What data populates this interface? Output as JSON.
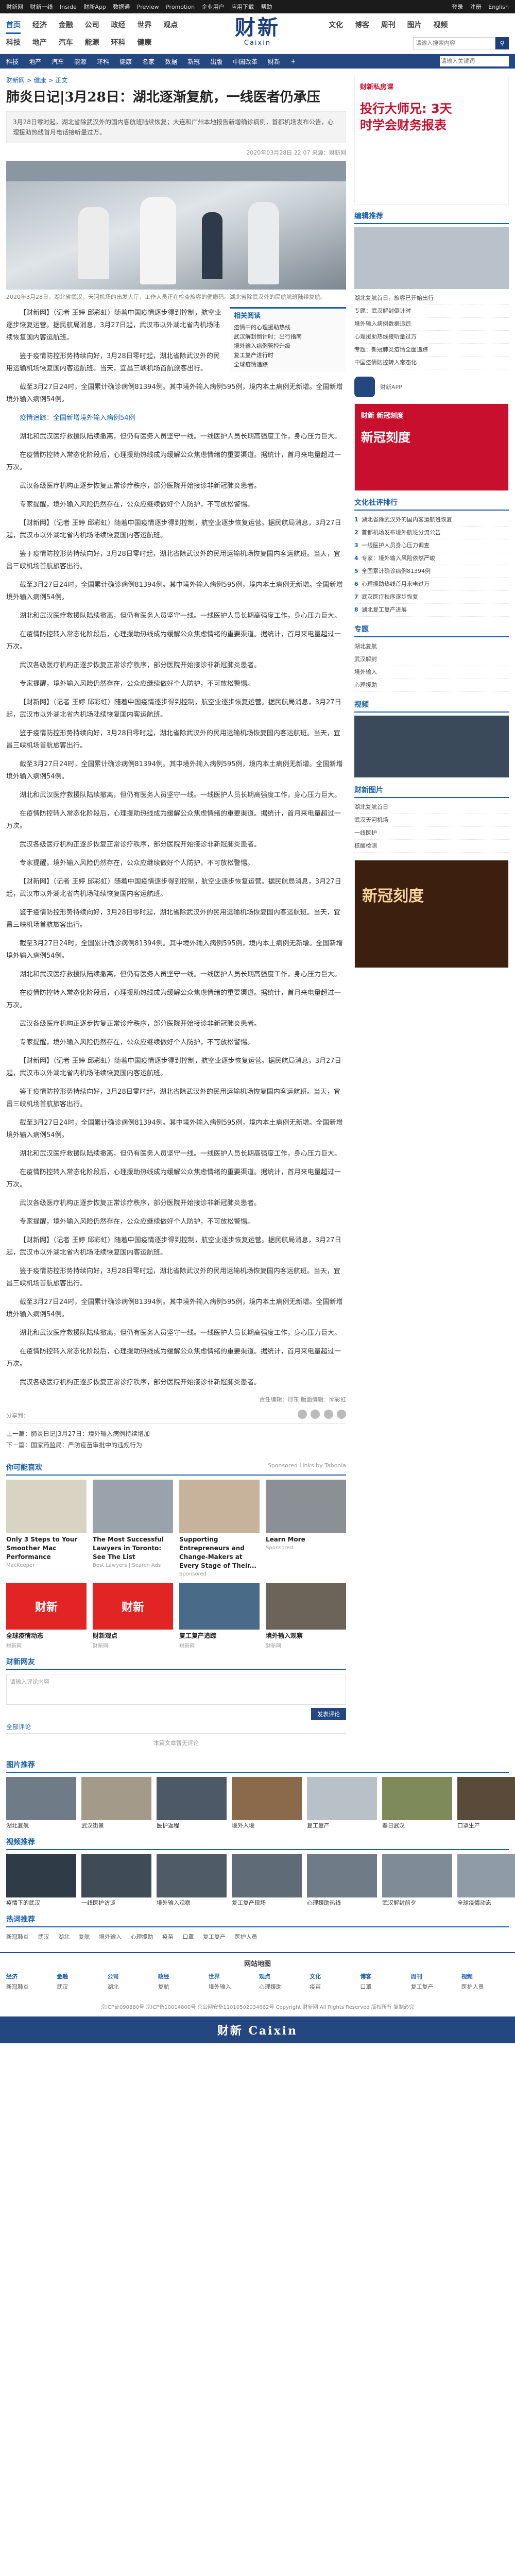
{
  "topbar": {
    "links": [
      "财新网",
      "财新一线",
      "Inside",
      "财新App",
      "数据通",
      "Preview",
      "Promotion",
      "企业用户",
      "应用下载",
      "帮助"
    ],
    "right": [
      "登录",
      "注册",
      "English"
    ]
  },
  "nav": {
    "row1": [
      "首页",
      "经济",
      "金融",
      "公司",
      "政经",
      "世界",
      "观点"
    ],
    "row1_active": "首页",
    "row1_right": [
      "文化",
      "博客",
      "周刊",
      "图片",
      "视频"
    ],
    "row2": [
      "科技",
      "地产",
      "汽车",
      "能源",
      "环科",
      "健康"
    ],
    "logo_cn": "财新",
    "logo_en": "Caixin",
    "search_placeholder": "请输入搜索内容",
    "account": "English"
  },
  "subnav": {
    "items": [
      "科技",
      "地产",
      "汽车",
      "能源",
      "环科",
      "健康",
      "名家",
      "数据",
      "新冠",
      "出版",
      "中国改革",
      "财新",
      "+"
    ],
    "search_placeholder": "请输入关键词"
  },
  "article": {
    "crumb": "财新网 > 健康 > 正文",
    "title": "肺炎日记|3月28日：湖北逐渐复航，一线医者仍承压",
    "summary": "3月28日零时起，湖北省除武汉外的国内客航班陆续恢复；大连和广州本地报告新增确诊病例，首都机场发布公告，心理援助热线首月电话接听量过万。",
    "meta": "2020年03月28日 22:07 来源：财新网",
    "caption": "2020年3月28日，湖北省武汉，天河机场的出发大厅，工作人员正在检查旅客的健康码。湖北省除武汉外的民航航班陆续复航。",
    "side_title": "相关阅读",
    "side_items": [
      "疫情中的心理援助热线",
      "武汉解封倒计时：出行指南",
      "境外输入病例管控升级",
      "复工复产进行时",
      "全球疫情追踪"
    ],
    "paragraphs": [
      "【财新网】（记者 王婷 邱彩虹）随着中国疫情逐步得到控制，航空业逐步恢复运营。据民航局消息，3月27日起，武汉市以外湖北省内机场陆续恢复国内客运航班。",
      "鉴于疫情防控形势持续向好，3月28日零时起，湖北省除武汉外的民用运输机场恢复国内客运航班。当天，宜昌三峡机场首航旅客出行。",
      "截至3月27日24时，全国累计确诊病例81394例。其中境外输入病例595例，境内本土病例无新增。全国新增境外输入病例54例。",
      "湖北和武汉医疗救援队陆续撤离，但仍有医务人员坚守一线。一线医护人员长期高强度工作，身心压力巨大。",
      "在疫情防控转入常态化阶段后，心理援助热线成为缓解公众焦虑情绪的重要渠道。据统计，首月来电量超过一万次。",
      "武汉各级医疗机构正逐步恢复正常诊疗秩序，部分医院开始接诊非新冠肺炎患者。",
      "专家提醒，境外输入风险仍然存在，公众应继续做好个人防护，不可放松警惕。"
    ],
    "related_link": "疫情追踪：全国新增境外输入病例54例",
    "editor": "责任编辑：邢东  版面编辑：邱彩虹",
    "share_label": "分享到：",
    "prev_label": "上一篇：",
    "prev": "肺炎日记|3月27日：境外输入病例持续增加",
    "next_label": "下一篇：",
    "next": "国家药监局：严防疫苗审批中的违规行为"
  },
  "recommend": {
    "title": "你可能喜欢",
    "sub": "Sponsored Links by Taboola",
    "cards": [
      {
        "t": "Only 3 Steps to Your Smoother Mac Performance",
        "s": "MacKeeper"
      },
      {
        "t": "The Most Successful Lawyers in Toronto: See The List",
        "s": "Best Lawyers | Search Ads"
      },
      {
        "t": "Supporting Entrepreneurs and Change-Makers at Every Stage of Their...",
        "s": "Sponsored"
      },
      {
        "t": "Learn More",
        "s": "Sponsored"
      }
    ],
    "cards2": [
      {
        "t": "全球疫情动态",
        "s": "财新网"
      },
      {
        "t": "财新观点",
        "s": "财新网"
      },
      {
        "t": "复工复产追踪",
        "s": "财新网"
      },
      {
        "t": "境外输入观察",
        "s": "财新网"
      }
    ],
    "caixin_logo": "财新"
  },
  "comment": {
    "title": "财新网友",
    "placeholder": "请输入评论内容",
    "submit": "发表评论",
    "tabs": "全部评论",
    "empty": "本篇文章暂无评论"
  },
  "right": {
    "ad1_top": "财新私房课",
    "ad1_big1": "投行大师兄: 3天",
    "ad1_big2": "时学会财务报表",
    "hot_title": "编辑推荐",
    "hot_items": [
      "湖北复航首日，旅客已开始出行",
      "专题：武汉解封倒计时",
      "境外输入病例数据追踪",
      "心理援助热线接听量过万",
      "专题：新冠肺炎疫情全面追踪",
      "中国疫情防控转入常态化"
    ],
    "ad2_title": "财新 新冠刻度",
    "ad2_big": "新冠刻度",
    "rank_title": "文化社评排行",
    "rank_items": [
      "湖北省除武汉外的国内客运航班恢复",
      "首都机场发布境外航班分流公告",
      "一线医护人员身心压力调查",
      "专家：境外输入风险依然严峻",
      "全国累计确诊病例81394例",
      "心理援助热线首月来电过万",
      "武汉医疗秩序逐步恢复",
      "湖北复工复产进展"
    ],
    "video_title": "视频",
    "special_title": "专题",
    "special_items": [
      "湖北复航",
      "武汉解封",
      "境外输入",
      "心理援助"
    ],
    "col_title": "财新图片",
    "col_items": [
      "湖北复航首日",
      "武汉天河机场",
      "一线医护",
      "核酸检测"
    ],
    "app_label": "财新APP"
  },
  "bottom": {
    "photo_title": "图片推荐",
    "photos": [
      "湖北复航",
      "武汉街景",
      "医护返程",
      "境外入境",
      "复工复产",
      "春日武汉",
      "口罩生产"
    ],
    "video_title": "视频推荐",
    "videos": [
      "疫情下的武汉",
      "一线医护访谈",
      "境外输入观察",
      "复工复产现场",
      "心理援助热线",
      "武汉解封前夕",
      "全球疫情动态"
    ],
    "kw_title": "热词推荐",
    "keywords": [
      "新冠肺炎",
      "武汉",
      "湖北",
      "复航",
      "境外输入",
      "心理援助",
      "疫苗",
      "口罩",
      "复工复产",
      "医护人员"
    ],
    "footer_title": "网站地图",
    "footer_cols": [
      "经济",
      "金融",
      "公司",
      "政经",
      "世界",
      "观点",
      "文化",
      "博客",
      "周刊",
      "视频"
    ],
    "copyright": "京ICP证090880号  京ICP备10014800号  京公网安备11010502034662号  Copyright 财新网 All Rights Reserved 版权所有 复制必究",
    "bottom_logo": "财新 Caixin"
  }
}
